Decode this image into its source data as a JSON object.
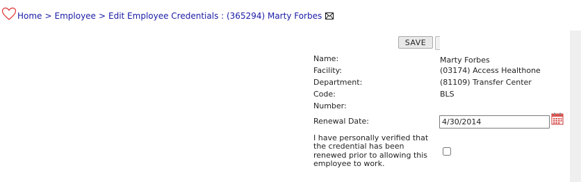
{
  "breadcrumb": {
    "home": "Home",
    "sep1": ">",
    "employee": "Employee",
    "sep2": ">",
    "current": "Edit Employee Credentials : (365294) Marty Forbes"
  },
  "toolbar": {
    "save_label": "SAVE"
  },
  "form": {
    "name_label": "Name:",
    "name_value": "Marty Forbes",
    "facility_label": "Facility:",
    "facility_value": "(03174) Access Healthone",
    "department_label": "Department:",
    "department_value": "(81109) Transfer Center",
    "code_label": "Code:",
    "code_value": "BLS",
    "number_label": "Number:",
    "renewal_label": "Renewal Date:",
    "renewal_value": "4/30/2014",
    "verify_text": "I have personally verified that the credential has been renewed prior to allowing this employee to work.",
    "verify_checked": false
  },
  "icons": {
    "logo": "heart-outline-icon",
    "email": "envelope-icon",
    "calendar": "calendar-icon"
  },
  "colors": {
    "link": "#1a1aa6",
    "heart": "#e03030",
    "calendar": "#d9534f"
  }
}
